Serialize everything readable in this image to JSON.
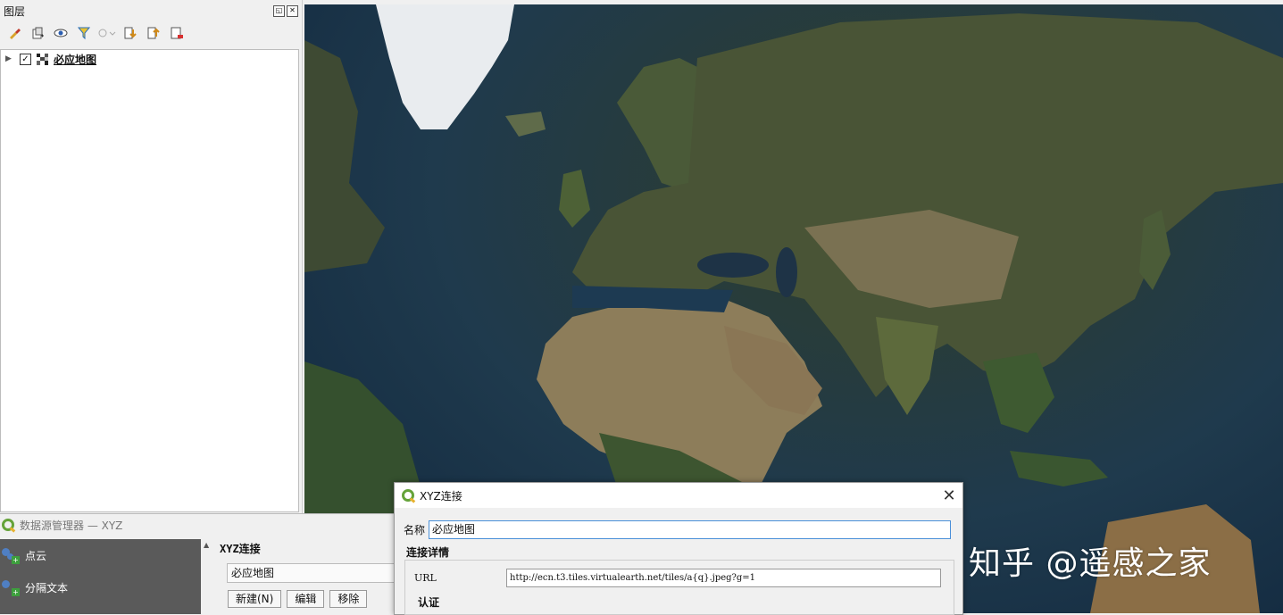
{
  "layers_panel": {
    "title": "图层",
    "layer": {
      "name": "必应地图",
      "checked": true
    }
  },
  "toolbar_icons": [
    "style-brush-icon",
    "add-group-icon",
    "eye-icon",
    "filter-icon",
    "legend-filter-icon",
    "expand-all-icon",
    "collapse-all-icon",
    "remove-layer-icon"
  ],
  "data_source_manager": {
    "title": "数据源管理器 — XYZ",
    "sidebar": [
      {
        "label": "点云",
        "icon": "point-cloud-icon"
      },
      {
        "label": "分隔文本",
        "icon": "delimited-text-icon"
      }
    ],
    "section_heading": "XYZ连接",
    "selected_connection": "必应地图",
    "buttons": {
      "new": "新建(N)",
      "edit": "编辑",
      "remove": "移除"
    }
  },
  "xyz_dialog": {
    "title": "XYZ连接",
    "name_label": "名称",
    "name_value": "必应地图",
    "group_title": "连接详情",
    "url_label": "URL",
    "url_value": "http://ecn.t3.tiles.virtualearth.net/tiles/a{q}.jpeg?g=1",
    "auth_label": "认证"
  },
  "watermark": "知乎 @遥感之家",
  "colors": {
    "qgis_green": "#65a33a",
    "qgis_yellow": "#e7b230",
    "sidebar_bg": "#5a5a5a",
    "focus_border": "#4a90d9"
  }
}
